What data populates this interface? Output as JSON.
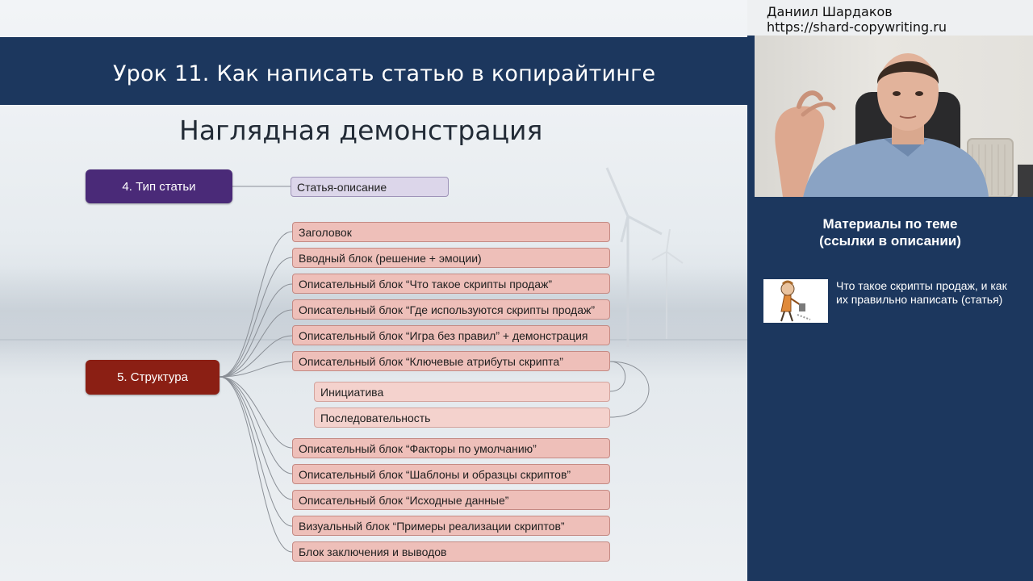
{
  "slide": {
    "lesson_title": "Урок 11. Как написать статью в копирайтинге",
    "section_title": "Наглядная демонстрация",
    "type_block": {
      "label": "4. Тип статьи",
      "value": "Статья-описание"
    },
    "structure_block": {
      "label": "5. Структура",
      "items": [
        "Заголовок",
        "Вводный блок (решение + эмоции)",
        "Описательный блок “Что такое скрипты продаж”",
        "Описательный блок “Где используются скрипты продаж”",
        "Описательный блок “Игра без правил” + демонстрация",
        "Описательный блок “Ключевые атрибуты скрипта”",
        "Инициатива",
        "Последовательность",
        "Описательный блок “Факторы по умолчанию”",
        "Описательный блок “Шаблоны и образцы скриптов”",
        "Описательный блок “Исходные данные”",
        "Визуальный блок “Примеры реализации скриптов”",
        "Блок заключения и выводов"
      ]
    }
  },
  "panel": {
    "author_name": "Даниил Шардаков",
    "author_url": "https://shard-copywriting.ru",
    "materials_title_1": "Материалы по теме",
    "materials_title_2": "(ссылки в описании)",
    "link_text": "Что такое скрипты продаж, и как их правильно написать (статья)"
  },
  "colors": {
    "header_blue": "#1c375e",
    "type_box": "#4a2a78",
    "structure_box": "#8b1f14",
    "node_pink": "#eebfb9",
    "node_lilac": "#dcd6ea"
  }
}
